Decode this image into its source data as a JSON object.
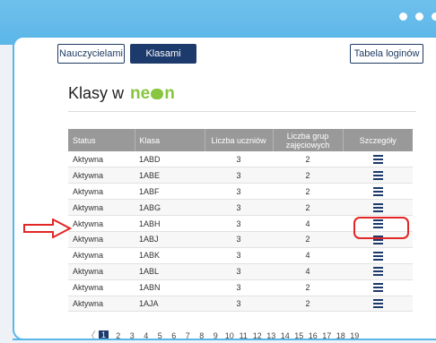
{
  "buttons": {
    "teachers": "Nauczycielami",
    "classes": "Klasami",
    "logins": "Tabela loginów"
  },
  "header": {
    "title_prefix": "Klasy w",
    "brand_left": "ne",
    "brand_right": "n"
  },
  "table": {
    "columns": [
      "Status",
      "Klasa",
      "Liczba uczniów",
      "Liczba grup zajęciowych",
      "Szczegóły"
    ],
    "rows": [
      {
        "status": "Aktywna",
        "class": "1ABD",
        "students": "3",
        "groups": "2"
      },
      {
        "status": "Aktywna",
        "class": "1ABE",
        "students": "3",
        "groups": "2"
      },
      {
        "status": "Aktywna",
        "class": "1ABF",
        "students": "3",
        "groups": "2"
      },
      {
        "status": "Aktywna",
        "class": "1ABG",
        "students": "3",
        "groups": "2"
      },
      {
        "status": "Aktywna",
        "class": "1ABH",
        "students": "3",
        "groups": "4"
      },
      {
        "status": "Aktywna",
        "class": "1ABJ",
        "students": "3",
        "groups": "2"
      },
      {
        "status": "Aktywna",
        "class": "1ABK",
        "students": "3",
        "groups": "4"
      },
      {
        "status": "Aktywna",
        "class": "1ABL",
        "students": "3",
        "groups": "4"
      },
      {
        "status": "Aktywna",
        "class": "1ABN",
        "students": "3",
        "groups": "2"
      },
      {
        "status": "Aktywna",
        "class": "1AJA",
        "students": "3",
        "groups": "2"
      }
    ],
    "details_icon": "list-icon"
  },
  "pagination": {
    "prev": "〈",
    "pages": [
      "1",
      "2",
      "3",
      "4",
      "5",
      "6",
      "7",
      "8",
      "9",
      "10",
      "11",
      "12",
      "13",
      "14",
      "15",
      "16",
      "17",
      "18",
      "19"
    ],
    "current": "1"
  },
  "colors": {
    "accent_blue": "#5bb6e8",
    "navy": "#1c3a6b",
    "brand_green": "#88c540",
    "annotation_red": "#e32626"
  }
}
